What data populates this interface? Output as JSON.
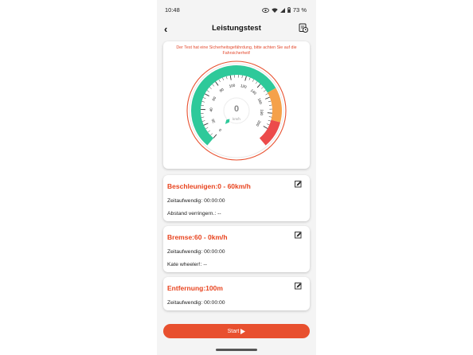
{
  "status_bar": {
    "time": "10:48",
    "battery": "73 %",
    "icons": [
      "eye-icon",
      "wifi-icon",
      "signal-icon",
      "battery-icon"
    ]
  },
  "header": {
    "title": "Leistungstest",
    "back_icon": "back-arrow-icon",
    "history_icon": "history-icon"
  },
  "gauge": {
    "warning": "Der Test hat eine Sicherheitsgefährdung, bitte achten Sie auf die Fahrsicherheit!",
    "speed": "0",
    "unit": "km/h",
    "ticks": [
      "0",
      "20",
      "40",
      "60",
      "80",
      "100",
      "120",
      "140",
      "160",
      "180",
      "200"
    ],
    "needle_value": 0,
    "max": 200,
    "colors": {
      "green": "#2ec99a",
      "orange": "#f5a14a",
      "red": "#ec4b4b",
      "ring": "#e8502f"
    }
  },
  "tests": [
    {
      "title": "Beschleunigen:0 - 60km/h",
      "time_label": "Zeitaufwendig: 00:00:00",
      "extra_label": "Abstand verringern.: --"
    },
    {
      "title": "Bremse:60 - 0km/h",
      "time_label": "Zeitaufwendig: 00:00:00",
      "extra_label": "Kate wheeler!: --"
    },
    {
      "title": "Entfernung:100m",
      "time_label": "Zeitaufwendig: 00:00:00"
    }
  ],
  "start_button": {
    "label": "Start"
  }
}
